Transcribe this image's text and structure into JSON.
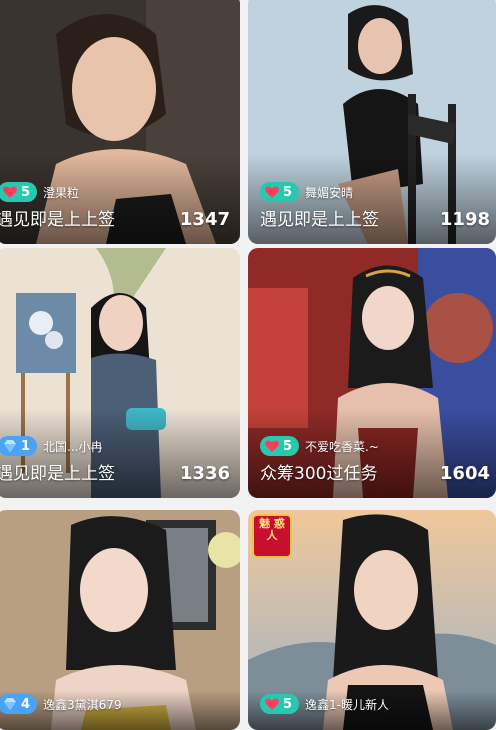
{
  "cards": [
    {
      "badge": "5",
      "user": "澄果粒",
      "title": "遇见即是上上签",
      "count": "1347"
    },
    {
      "badge": "5",
      "user": "舞媚安晴",
      "title": "遇见即是上上签",
      "count": "1198"
    },
    {
      "badge": "1",
      "user": "北国...小冉",
      "title": "遇见即是上上签",
      "count": "1336"
    },
    {
      "badge": "5",
      "user": "不爱吃香菜.~",
      "title": "众筹300过任务",
      "count": "1604"
    },
    {
      "badge": "4",
      "user": "逸鑫3黛淇679",
      "title": "",
      "count": ""
    },
    {
      "badge": "5",
      "user": "逸鑫1-暖儿新人",
      "title": "",
      "count": ""
    }
  ],
  "corner_badge": "魅 惑 人",
  "colors": {
    "heart_pill": "#27c9ae",
    "diamond_pill": "#4aa3f5",
    "heart": "#ff3b5c"
  }
}
